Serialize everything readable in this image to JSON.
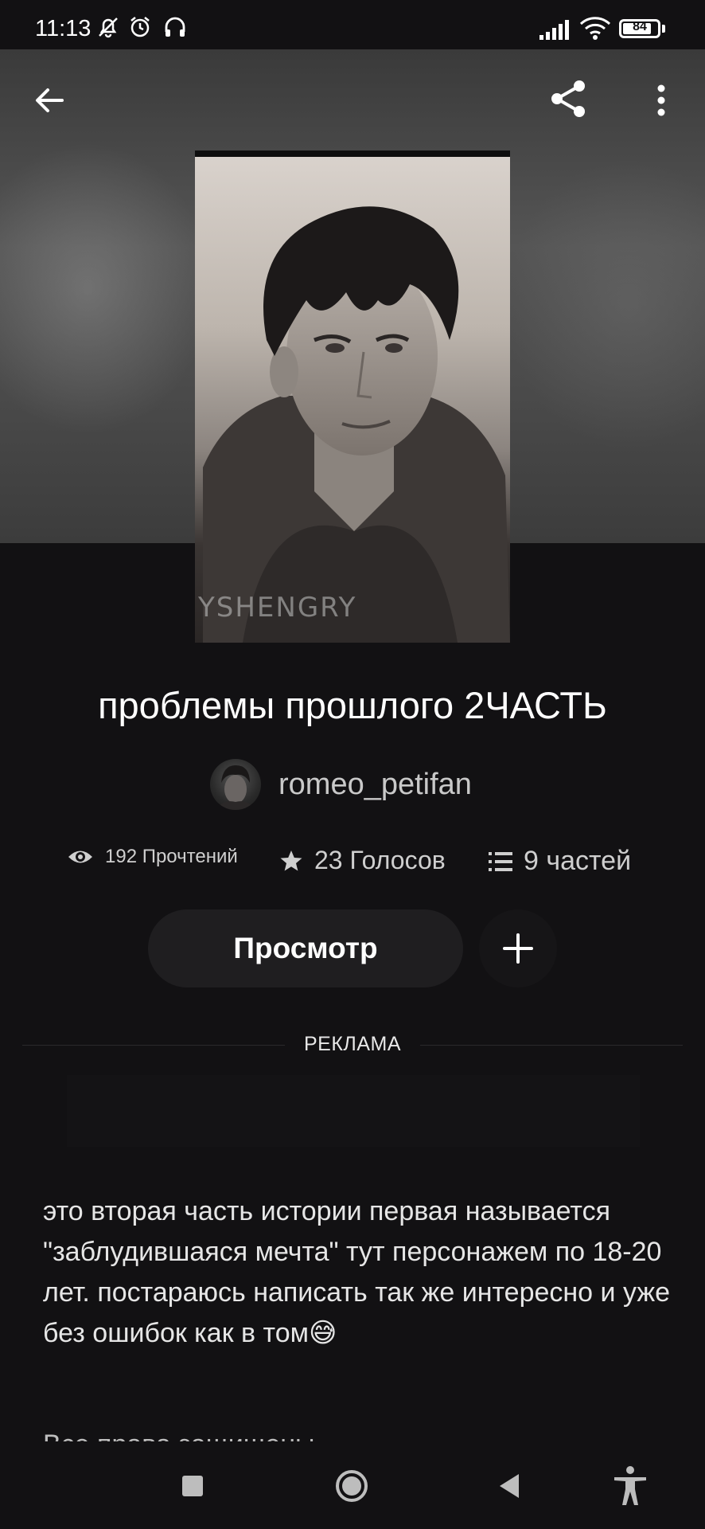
{
  "status_bar": {
    "time": "11:13",
    "battery": "84",
    "battery_level": 0.84,
    "icons": [
      "bell-off-icon",
      "alarm-icon",
      "headphones-icon",
      "signal-icon",
      "wifi-icon",
      "battery-icon"
    ]
  },
  "top_bar": {
    "icons": [
      "back-arrow-icon",
      "share-icon",
      "more-vertical-icon"
    ]
  },
  "cover": {
    "watermark": "YSHENGRY"
  },
  "story": {
    "title": "проблемы прошлого 2ЧАСТЬ",
    "author": "romeo_petifan",
    "reads": "192 Прочтений",
    "votes": "23 Голосов",
    "parts": "9 частей"
  },
  "actions": {
    "view_label": "Просмотр",
    "add_icon": "plus-icon"
  },
  "ad": {
    "label": "РЕКЛАМА"
  },
  "description": "это вторая часть истории первая называется \"заблудившаяся мечта\" тут персонажем по 18-20 лет. постараюсь написать так же интересно и уже без ошибок как в том😅",
  "rights_partial": "Все права защищены",
  "nav": {
    "icons": [
      "recents-square-icon",
      "home-circle-icon",
      "back-triangle-icon",
      "accessibility-icon"
    ]
  },
  "colors": {
    "background": "#121113",
    "button": "#1f1e20",
    "text": "#ffffff",
    "muted": "#c9c9c9"
  }
}
